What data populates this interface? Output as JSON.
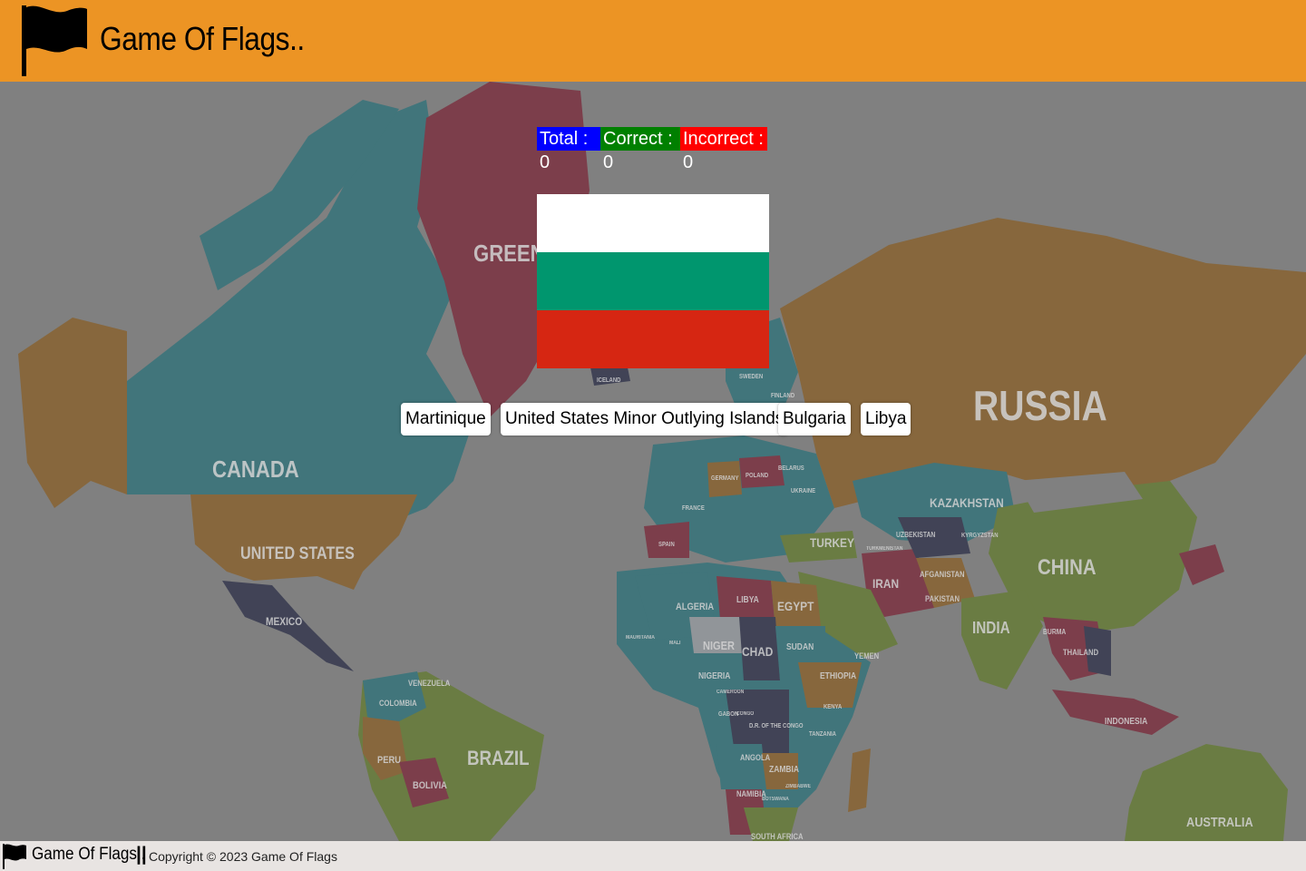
{
  "header": {
    "title": "Game Of Flags..",
    "icon": "flag-icon"
  },
  "map": {
    "labels": [
      "GREENLAND",
      "CANADA",
      "UNITED STATES",
      "RUSSIA",
      "KAZAKHSTAN",
      "CHINA",
      "IRAN",
      "INDIA",
      "BRAZIL",
      "AUSTRALIA",
      "LIBYA",
      "EGYPT",
      "CHAD",
      "SUDAN",
      "ALGERIA",
      "NIGER",
      "TURKEY",
      "MEXICO",
      "COLOMBIA",
      "VENEZUELA",
      "PERU",
      "BOLIVIA",
      "ETHIOPIA",
      "NIGERIA",
      "ANGOLA",
      "ZAMBIA",
      "NAMIBIA",
      "SOUTH AFRICA",
      "D.R. OF THE CONGO",
      "TANZANIA",
      "FINLAND",
      "SWEDEN",
      "ICELAND",
      "POLAND",
      "UKRAINE",
      "BELARUS",
      "GERMANY",
      "FRANCE",
      "SPAIN",
      "INDONESIA",
      "AFGANISTAN",
      "PAKISTAN",
      "YEMEN",
      "KENYA",
      "UZBEKISTAN",
      "TURKMENISTAN",
      "KYRGYZSTAN",
      "MAURITANIA",
      "MALI",
      "BURMA",
      "THAILAND",
      "ZIMBABWE",
      "BOTSWANA",
      "CAMEROON",
      "GABON",
      "CONGO"
    ],
    "colors": {
      "teal": "#1f6f78",
      "maroon": "#7a1b2e",
      "gold": "#8a5a1a",
      "olive": "#5f7a22",
      "navy": "#1f2340",
      "ocean": "#808080"
    }
  },
  "scoreboard": {
    "total_label": "Total : 0",
    "correct_label": "Correct : 0",
    "incorrect_label": "Incorrect : 0",
    "total_color": "#0000ff",
    "correct_color": "#008000",
    "incorrect_color": "#ff0000"
  },
  "flag": {
    "stripes": [
      "#ffffff",
      "#00966e",
      "#d62612"
    ]
  },
  "options": [
    "Martinique",
    "United States Minor Outlying Islands",
    "Bulgaria",
    "Libya"
  ],
  "footer": {
    "title": "Game Of Flags..",
    "separator": "||",
    "copyright": "Copyright © 2023 Game Of Flags"
  }
}
